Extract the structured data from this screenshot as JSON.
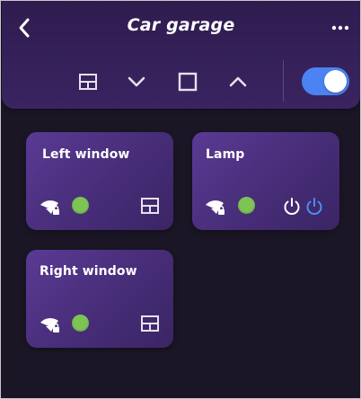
{
  "header": {
    "title": "Car garage",
    "toggle_on": true,
    "colors": {
      "accent": "#4b83f2",
      "header_bg": "#2f1c4f"
    },
    "controls": [
      "window-icon",
      "chevron-down-icon",
      "stop-square-icon",
      "chevron-up-icon"
    ]
  },
  "devices": [
    {
      "name": "Left window",
      "icons": [
        "wifi-locked-icon",
        "window-icon"
      ],
      "status_color": "#7dc455"
    },
    {
      "name": "Lamp",
      "icons": [
        "wifi-locked-icon",
        "power-off-icon",
        "power-on-icon"
      ],
      "status_color": "#7dc455"
    },
    {
      "name": "Right window",
      "icons": [
        "wifi-locked-icon",
        "window-icon"
      ],
      "status_color": "#7dc455"
    }
  ]
}
